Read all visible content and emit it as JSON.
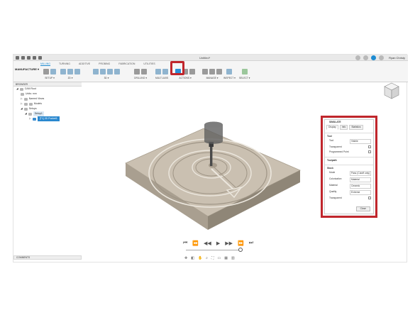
{
  "titlebar": {
    "doc_title": "Untitled*",
    "user_name": "Ryan Christy"
  },
  "ribbon": {
    "workspace": "MANUFACTURE ▾",
    "tabs": [
      "MILLING",
      "TURNING",
      "ADDITIVE",
      "PROBING",
      "FABRICATION",
      "UTILITIES"
    ],
    "groups": [
      "SETUP ▾",
      "2D ▾",
      "3D ▾",
      "DRILLING ▾",
      "MULTI-AXIS",
      "ACTIONS ▾",
      "MANAGE ▾",
      "INSPECT ▾",
      "SELECT ▾"
    ]
  },
  "browser": {
    "header": "BROWSER",
    "items": [
      "CAM Root",
      "Units: mm",
      "Named Views",
      "Models",
      "Setups",
      "Setup1",
      "[T1] 2D Pocket1"
    ]
  },
  "comments": {
    "label": "COMMENTS"
  },
  "simulate": {
    "title": "SIMULATE",
    "tabs": [
      "Display",
      "Info",
      "Statistics"
    ],
    "tool_section": "Tool",
    "tool_rows": [
      {
        "label": "Tool",
        "value": "Visible"
      },
      {
        "label": "Transparent",
        "value": ""
      },
      {
        "label": "Programmed Point",
        "value": ""
      }
    ],
    "toolpath_section": "Toolpath",
    "stock_section": "Stock",
    "stock_rows": [
      {
        "label": "Mode",
        "value": "Pass (Cutoff only)"
      },
      {
        "label": "Colorization",
        "value": "Material"
      },
      {
        "label": "Material",
        "value": "Ceramic"
      },
      {
        "label": "Quality",
        "value": "Extreme"
      },
      {
        "label": "Transparent",
        "value": ""
      }
    ],
    "close_label": "Close"
  },
  "playback": {
    "controls": [
      "⏮",
      "⏪",
      "◀◀",
      "▶",
      "▶▶",
      "⏩",
      "⏭"
    ]
  },
  "colors": {
    "accent": "#1d8bd1",
    "highlight": "#c0262c",
    "stock": "#cac0b1"
  }
}
